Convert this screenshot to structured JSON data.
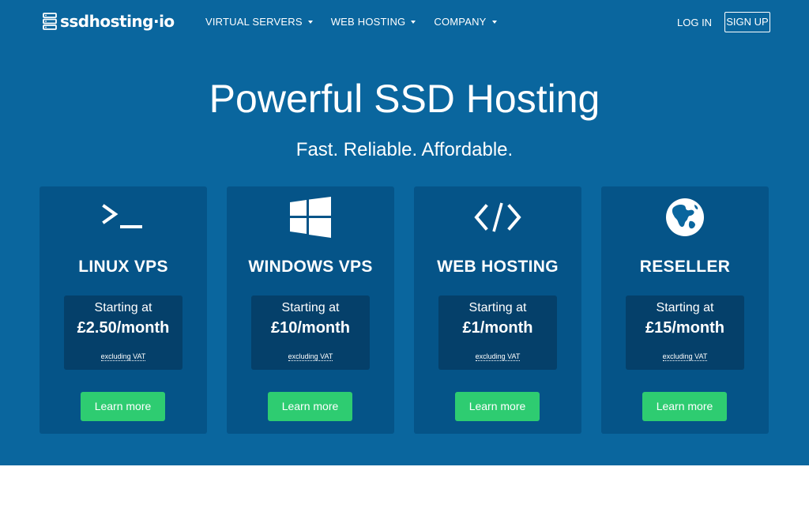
{
  "brand": {
    "name": "ssdhosting·io",
    "logo_icon": "server-stack-icon"
  },
  "nav": {
    "items": [
      {
        "label": "VIRTUAL SERVERS",
        "icon": "caret-down-icon"
      },
      {
        "label": "WEB HOSTING",
        "icon": "caret-down-icon"
      },
      {
        "label": "COMPANY",
        "icon": "caret-down-icon"
      }
    ],
    "login_label": "LOG IN",
    "signup_label": "SIGN UP"
  },
  "hero": {
    "headline": "Powerful SSD Hosting",
    "tagline": "Fast. Reliable. Affordable."
  },
  "cards": [
    {
      "title": "LINUX VPS",
      "icon": "terminal-icon",
      "starting": "Starting at",
      "price": "£2.50/month",
      "vat": "excluding VAT",
      "button": "Learn more"
    },
    {
      "title": "WINDOWS VPS",
      "icon": "windows-logo-icon",
      "starting": "Starting at",
      "price": "£10/month",
      "vat": "excluding VAT",
      "button": "Learn more"
    },
    {
      "title": "WEB HOSTING",
      "icon": "code-icon",
      "starting": "Starting at",
      "price": "£1/month",
      "vat": "excluding VAT",
      "button": "Learn more"
    },
    {
      "title": "RESELLER",
      "icon": "globe-icon",
      "starting": "Starting at",
      "price": "£15/month",
      "vat": "excluding VAT",
      "button": "Learn more"
    }
  ],
  "colors": {
    "hero_bg": "#0a669e",
    "card_bg": "#055488",
    "price_box_bg": "#05406a",
    "button_green": "#2ecc71"
  }
}
